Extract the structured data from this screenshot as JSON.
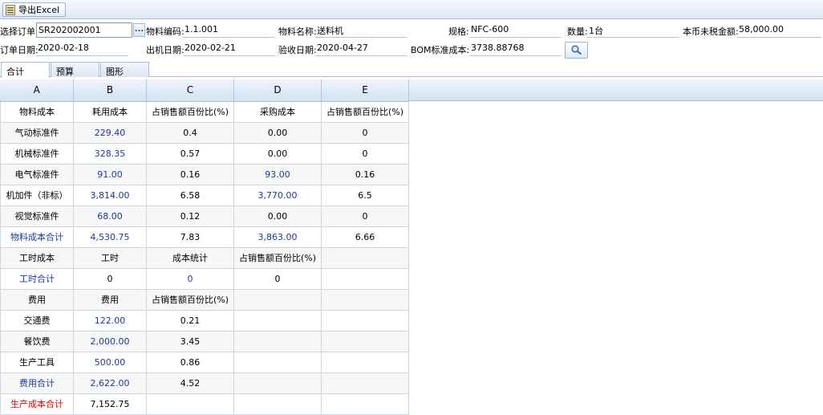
{
  "toolbar": {
    "export_label": "导出Excel",
    "export_icon": "excel-icon"
  },
  "form": {
    "order_label": "选择订单",
    "order_value": "SR202002001",
    "order_btn": "...",
    "code_label": "物料编码:",
    "code_value": "1.1.001",
    "name_label": "物料名称:",
    "name_value": "送料机",
    "spec_label": "规格:",
    "spec_value": "NFC-600",
    "qty_label": "数量:",
    "qty_value": "1台",
    "amount_label": "本币未税金额:",
    "amount_value": "58,000.00",
    "orderdate_label": "订单日期:",
    "orderdate_value": "2020-02-18",
    "shipdate_label": "出机日期:",
    "shipdate_value": "2020-02-21",
    "acceptdate_label": "验收日期:",
    "acceptdate_value": "2020-04-27",
    "bom_label": "BOM标准成本:",
    "bom_value": "3738.88768"
  },
  "tabs": [
    "合计",
    "预算",
    "图形"
  ],
  "grid": {
    "columns": [
      "A",
      "B",
      "C",
      "D",
      "E"
    ],
    "rows": [
      [
        {
          "t": "物料成本"
        },
        {
          "t": "耗用成本"
        },
        {
          "t": "占销售额百份比(%)"
        },
        {
          "t": "采购成本"
        },
        {
          "t": "占销售额百份比(%)"
        }
      ],
      [
        {
          "t": "气动标准件"
        },
        {
          "t": "229.40",
          "c": "blue"
        },
        {
          "t": "0.4"
        },
        {
          "t": "0.00"
        },
        {
          "t": "0"
        }
      ],
      [
        {
          "t": "机械标准件"
        },
        {
          "t": "328.35",
          "c": "blue"
        },
        {
          "t": "0.57"
        },
        {
          "t": "0.00"
        },
        {
          "t": "0"
        }
      ],
      [
        {
          "t": "电气标准件"
        },
        {
          "t": "91.00",
          "c": "blue"
        },
        {
          "t": "0.16"
        },
        {
          "t": "93.00",
          "c": "blue"
        },
        {
          "t": "0.16"
        }
      ],
      [
        {
          "t": "机加件（非标）"
        },
        {
          "t": "3,814.00",
          "c": "blue"
        },
        {
          "t": "6.58"
        },
        {
          "t": "3,770.00",
          "c": "blue"
        },
        {
          "t": "6.5"
        }
      ],
      [
        {
          "t": "视觉标准件"
        },
        {
          "t": "68.00",
          "c": "blue"
        },
        {
          "t": "0.12"
        },
        {
          "t": "0.00"
        },
        {
          "t": "0"
        }
      ],
      [
        {
          "t": "物料成本合计",
          "c": "blue"
        },
        {
          "t": "4,530.75",
          "c": "blue"
        },
        {
          "t": "7.83"
        },
        {
          "t": "3,863.00",
          "c": "blue"
        },
        {
          "t": "6.66"
        }
      ],
      [
        {
          "t": "工时成本"
        },
        {
          "t": "工时"
        },
        {
          "t": "成本统计"
        },
        {
          "t": "占销售额百份比(%)"
        },
        {
          "t": ""
        }
      ],
      [
        {
          "t": "工时合计",
          "c": "blue"
        },
        {
          "t": "0"
        },
        {
          "t": "0",
          "c": "blue"
        },
        {
          "t": "0"
        },
        {
          "t": ""
        }
      ],
      [
        {
          "t": "费用"
        },
        {
          "t": "费用"
        },
        {
          "t": "占销售额百份比(%)"
        },
        {
          "t": ""
        },
        {
          "t": ""
        }
      ],
      [
        {
          "t": "交通费"
        },
        {
          "t": "122.00",
          "c": "blue"
        },
        {
          "t": "0.21"
        },
        {
          "t": ""
        },
        {
          "t": ""
        }
      ],
      [
        {
          "t": "餐饮费"
        },
        {
          "t": "2,000.00",
          "c": "blue"
        },
        {
          "t": "3.45"
        },
        {
          "t": ""
        },
        {
          "t": ""
        }
      ],
      [
        {
          "t": "生产工具"
        },
        {
          "t": "500.00",
          "c": "blue"
        },
        {
          "t": "0.86"
        },
        {
          "t": ""
        },
        {
          "t": ""
        }
      ],
      [
        {
          "t": "费用合计",
          "c": "blue"
        },
        {
          "t": "2,622.00",
          "c": "blue"
        },
        {
          "t": "4.52"
        },
        {
          "t": ""
        },
        {
          "t": ""
        }
      ],
      [
        {
          "t": "生产成本合计",
          "c": "red"
        },
        {
          "t": "7,152.75"
        },
        {
          "t": ""
        },
        {
          "t": ""
        },
        {
          "t": ""
        }
      ]
    ]
  },
  "colors": {
    "blue": "#1a3a9c",
    "red": "#e00000",
    "header": "#d4e2f2"
  }
}
